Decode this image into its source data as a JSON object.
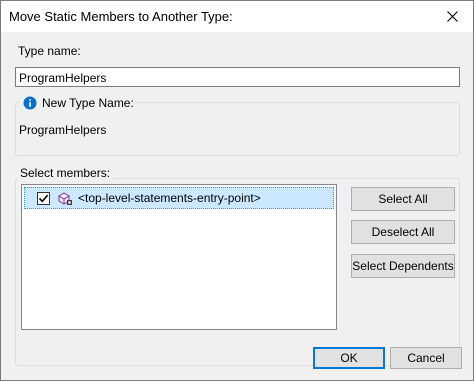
{
  "window": {
    "title": "Move Static Members to Another Type:"
  },
  "type_name": {
    "label": "Type name:",
    "value": "ProgramHelpers"
  },
  "new_type": {
    "label": "New Type Name:",
    "value": "ProgramHelpers",
    "icon": "info-icon",
    "icon_color": "#0b6fcc"
  },
  "members": {
    "label": "Select members:",
    "items": [
      {
        "checked": true,
        "icon": "static-member-icon",
        "text": "<top-level-statements-entry-point>"
      }
    ]
  },
  "buttons": {
    "select_all": "Select All",
    "deselect_all": "Deselect All",
    "select_dependents": "Select Dependents",
    "ok": "OK",
    "cancel": "Cancel"
  },
  "colors": {
    "selection_bg": "#cce8ff",
    "selection_border": "#26a0da",
    "accent": "#0078d7"
  }
}
